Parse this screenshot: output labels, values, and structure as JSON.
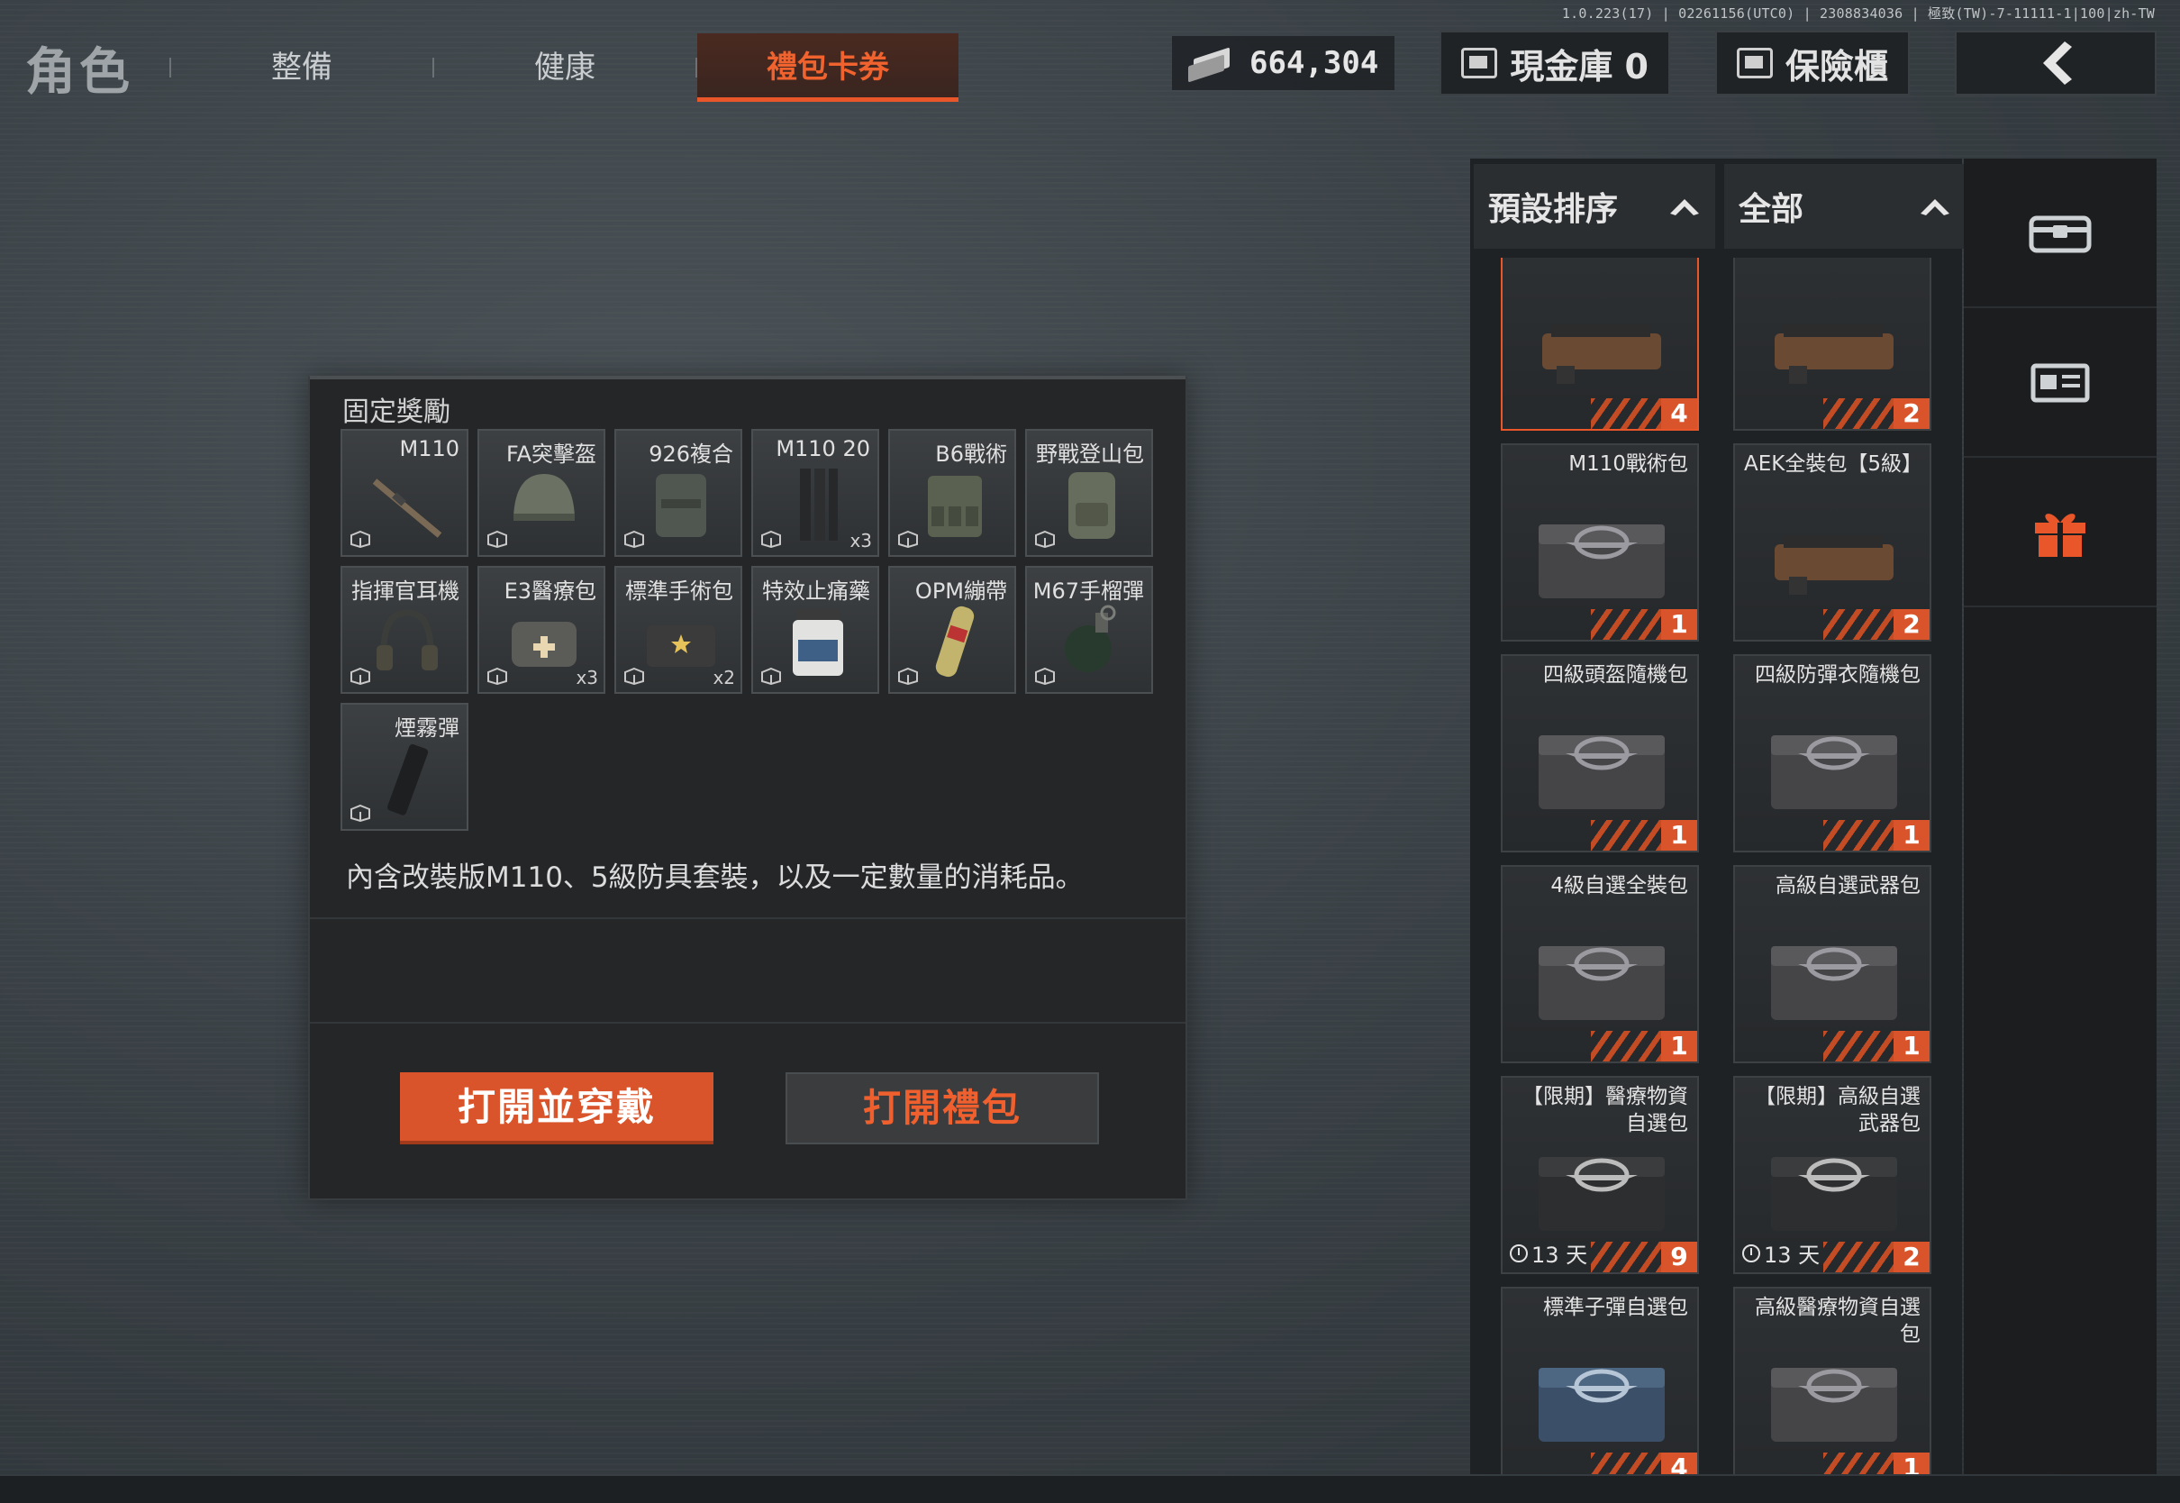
{
  "version": "1.0.223(17) | 02261156(UTC0) | 2308834036 | 極致(TW)-7-11111-1|100|zh-TW",
  "nav": {
    "title": "角色",
    "tabs": [
      {
        "label": "整備"
      },
      {
        "label": "健康"
      },
      {
        "label": "禮包卡券",
        "active": true
      }
    ]
  },
  "topbar": {
    "money": "664,304",
    "cash_label": "現金庫 0",
    "safe_label": "保險櫃"
  },
  "panel": {
    "title": "固定獎勵",
    "rewards": [
      {
        "label": "M110",
        "qty": "",
        "icon": "rifle-icon"
      },
      {
        "label": "FA突擊盔",
        "qty": "",
        "icon": "helmet-icon"
      },
      {
        "label": "926複合",
        "qty": "",
        "icon": "vest-icon"
      },
      {
        "label": "M110 20",
        "qty": "x3",
        "icon": "magazine-icon"
      },
      {
        "label": "B6戰術",
        "qty": "",
        "icon": "tactical-rig-icon"
      },
      {
        "label": "野戰登山包",
        "qty": "",
        "icon": "backpack-icon"
      },
      {
        "label": "指揮官耳機",
        "qty": "",
        "icon": "headset-icon"
      },
      {
        "label": "E3醫療包",
        "qty": "x3",
        "icon": "medkit-icon"
      },
      {
        "label": "標準手術包",
        "qty": "x2",
        "icon": "surgical-kit-icon"
      },
      {
        "label": "特效止痛藥",
        "qty": "",
        "icon": "painkiller-icon"
      },
      {
        "label": "OPM繃帶",
        "qty": "",
        "icon": "bandage-icon"
      },
      {
        "label": "M67手榴彈",
        "qty": "",
        "icon": "grenade-icon"
      },
      {
        "label": "煙霧彈",
        "qty": "",
        "icon": "smoke-grenade-icon"
      }
    ],
    "description": "內含改裝版M110、5級防具套裝，以及一定數量的消耗品。",
    "equip_button": "打開並穿戴",
    "open_button": "打開禮包"
  },
  "inventory": {
    "sort_label": "預設排序",
    "filter_label": "全部",
    "items": [
      {
        "name": "",
        "count": "4",
        "selected": true,
        "timer": "",
        "kind": "weapon"
      },
      {
        "name": "",
        "count": "2",
        "selected": false,
        "timer": "",
        "kind": "weapon"
      },
      {
        "name": "M110戰術包",
        "count": "1",
        "selected": false,
        "timer": "",
        "kind": "crate"
      },
      {
        "name": "AEK全裝包【5級】",
        "count": "2",
        "selected": false,
        "timer": "",
        "kind": "weapon"
      },
      {
        "name": "四級頭盔隨機包",
        "count": "1",
        "selected": false,
        "timer": "",
        "kind": "crate"
      },
      {
        "name": "四級防彈衣隨機包",
        "count": "1",
        "selected": false,
        "timer": "",
        "kind": "crate"
      },
      {
        "name": "4級自選全裝包",
        "count": "1",
        "selected": false,
        "timer": "",
        "kind": "crate"
      },
      {
        "name": "高級自選武器包",
        "count": "1",
        "selected": false,
        "timer": "",
        "kind": "crate"
      },
      {
        "name": "【限期】醫療物資自選包",
        "count": "9",
        "selected": false,
        "timer": "13 天",
        "kind": "dark-crate"
      },
      {
        "name": "【限期】高級自選武器包",
        "count": "2",
        "selected": false,
        "timer": "13 天",
        "kind": "dark-crate"
      },
      {
        "name": "標準子彈自選包",
        "count": "4",
        "selected": false,
        "timer": "",
        "kind": "blue-crate"
      },
      {
        "name": "高級醫療物資自選包",
        "count": "1",
        "selected": false,
        "timer": "",
        "kind": "crate"
      }
    ]
  },
  "side_tabs": [
    {
      "icon": "treasure-chest-icon"
    },
    {
      "icon": "id-card-icon"
    },
    {
      "icon": "gift-icon",
      "active": true
    }
  ],
  "colors": {
    "accent": "#e8562a",
    "panel": "#242628",
    "background": "#3a4146"
  }
}
